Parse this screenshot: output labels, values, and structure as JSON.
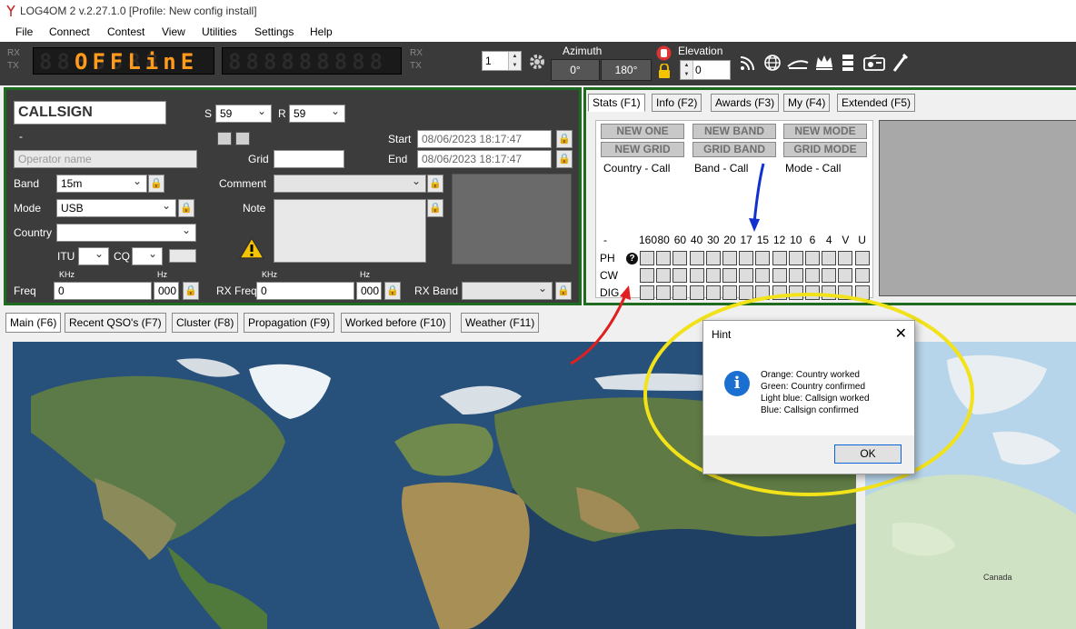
{
  "window": {
    "title": "LOG4OM 2 v.2.27.1.0 [Profile: New config install]"
  },
  "menu": [
    "File",
    "Connect",
    "Contest",
    "View",
    "Utilities",
    "Settings",
    "Help"
  ],
  "toolbar": {
    "rx": "RX",
    "tx": "TX",
    "led_status": "OFFLinE",
    "led_freq_ghost": "888888888",
    "led_status_ghost": "8888888",
    "radio_number": "1",
    "azimuth_label": "Azimuth",
    "azimuth_value": "0°",
    "azimuth_reverse": "180°",
    "elevation_label": "Elevation",
    "elevation_value": "0"
  },
  "qso": {
    "callsign": "CALLSIGN",
    "rst_s_label": "S",
    "rst_s": "59",
    "rst_r_label": "R",
    "rst_r": "59",
    "dash": "-",
    "operator_placeholder": "Operator name",
    "grid_label": "Grid",
    "start_label": "Start",
    "start_value": "08/06/2023 18:17:47",
    "end_label": "End",
    "end_value": "08/06/2023 18:17:47",
    "band_label": "Band",
    "band_value": "15m",
    "comment_label": "Comment",
    "mode_label": "Mode",
    "mode_value": "USB",
    "note_label": "Note",
    "country_label": "Country",
    "itu_label": "ITU",
    "cq_label": "CQ",
    "khz": "KHz",
    "hz": "Hz",
    "freq_label": "Freq",
    "freq_khz": "0",
    "freq_hz": "000",
    "rxfreq_label": "RX Freq",
    "rxfreq_khz": "0",
    "rxfreq_hz": "000",
    "rxband_label": "RX Band"
  },
  "stats": {
    "tabs": [
      "Stats (F1)",
      "Info (F2)",
      "Awards (F3)",
      "My (F4)",
      "Extended (F5)"
    ],
    "buttons": [
      "NEW ONE",
      "NEW BAND",
      "NEW MODE",
      "NEW GRID",
      "GRID BAND",
      "GRID MODE"
    ],
    "labels": [
      "Country - Call",
      "Band - Call",
      "Mode - Call"
    ],
    "dash": "-",
    "bands": [
      "160",
      "80",
      "60",
      "40",
      "30",
      "20",
      "17",
      "15",
      "12",
      "10",
      "6",
      "4",
      "V",
      "U"
    ],
    "modes": [
      "PH",
      "CW",
      "DIG"
    ]
  },
  "bottom_tabs": [
    "Main (F6)",
    "Recent QSO's (F7)",
    "Cluster (F8)",
    "Propagation (F9)",
    "Worked before (F10)",
    "Weather (F11)"
  ],
  "map": {
    "label_canada": "Canada"
  },
  "hint": {
    "title": "Hint",
    "lines": [
      "Orange: Country worked",
      "Green: Country confirmed",
      "Light blue: Callsign worked",
      "Blue: Callsign confirmed"
    ],
    "ok": "OK"
  },
  "colors": {
    "panel_border": "#1f6b1f",
    "led_on": "#ff9a1a",
    "annotation_red": "#e02020",
    "annotation_blue": "#1030d0",
    "annotation_yellow": "#f2e21a",
    "ocean": "#27507a"
  }
}
